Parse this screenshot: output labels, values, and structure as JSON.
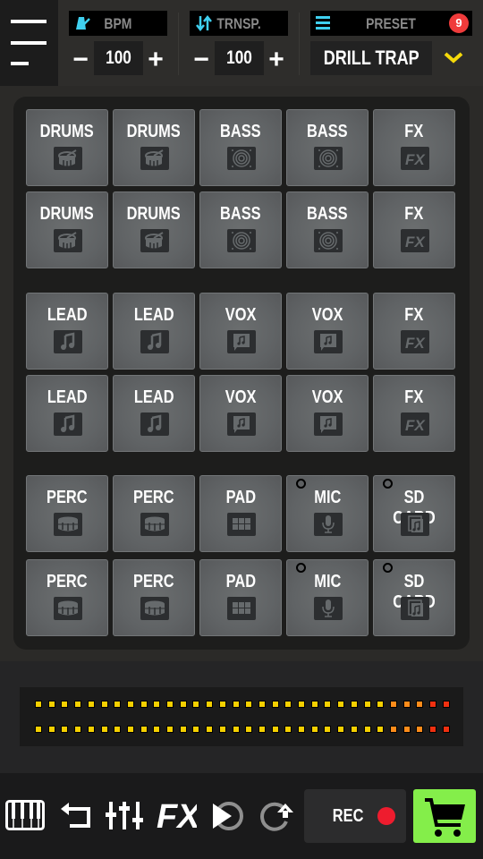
{
  "header": {
    "bpm": {
      "label": "BPM",
      "value": "100",
      "minus": "−",
      "plus": "+",
      "icon": "metronome-icon"
    },
    "transpose": {
      "label": "TRNSP.",
      "value": "100",
      "minus": "−",
      "plus": "+",
      "icon": "transpose-arrows-icon"
    },
    "preset": {
      "label": "PRESET",
      "badge": "9",
      "name": "DRILL TRAP",
      "icon": "list-icon",
      "dropdown_icon": "chevron-down-icon"
    }
  },
  "colors": {
    "accent_cyan": "#3fd0f0",
    "badge_red": "#ef3b3b",
    "chevron_yellow": "#f5d90a",
    "led_yellow": "#f5d000",
    "led_orange": "#ff8c1a",
    "led_red": "#f03010",
    "rec_red": "#ee1c2e",
    "cart_green": "#84ee4a"
  },
  "pad_groups": [
    {
      "rows": [
        [
          {
            "label": "DRUMS",
            "icon": "drum"
          },
          {
            "label": "DRUMS",
            "icon": "drum"
          },
          {
            "label": "BASS",
            "icon": "speaker"
          },
          {
            "label": "BASS",
            "icon": "speaker"
          },
          {
            "label": "FX",
            "icon": "fx"
          }
        ],
        [
          {
            "label": "DRUMS",
            "icon": "drum"
          },
          {
            "label": "DRUMS",
            "icon": "drum"
          },
          {
            "label": "BASS",
            "icon": "speaker"
          },
          {
            "label": "BASS",
            "icon": "speaker"
          },
          {
            "label": "FX",
            "icon": "fx"
          }
        ]
      ]
    },
    {
      "rows": [
        [
          {
            "label": "LEAD",
            "icon": "note"
          },
          {
            "label": "LEAD",
            "icon": "note"
          },
          {
            "label": "VOX",
            "icon": "vox"
          },
          {
            "label": "VOX",
            "icon": "vox"
          },
          {
            "label": "FX",
            "icon": "fx"
          }
        ],
        [
          {
            "label": "LEAD",
            "icon": "note"
          },
          {
            "label": "LEAD",
            "icon": "note"
          },
          {
            "label": "VOX",
            "icon": "vox"
          },
          {
            "label": "VOX",
            "icon": "vox"
          },
          {
            "label": "FX",
            "icon": "fx"
          }
        ]
      ]
    },
    {
      "rows": [
        [
          {
            "label": "PERC",
            "icon": "perc"
          },
          {
            "label": "PERC",
            "icon": "perc"
          },
          {
            "label": "PAD",
            "icon": "grid"
          },
          {
            "label": "MIC",
            "icon": "mic",
            "dot": true
          },
          {
            "label": "SD CARD",
            "icon": "sdcard",
            "dot": true
          }
        ],
        [
          {
            "label": "PERC",
            "icon": "perc"
          },
          {
            "label": "PERC",
            "icon": "perc"
          },
          {
            "label": "PAD",
            "icon": "grid"
          },
          {
            "label": "MIC",
            "icon": "mic",
            "dot": true
          },
          {
            "label": "SD CARD",
            "icon": "sdcard",
            "dot": true
          }
        ]
      ]
    }
  ],
  "level_meter": {
    "channels": 2,
    "segments_per_channel": 32,
    "lit_segments": [
      32,
      32
    ],
    "segment_colors": [
      "yellow",
      "yellow",
      "yellow",
      "yellow",
      "yellow",
      "yellow",
      "yellow",
      "yellow",
      "yellow",
      "yellow",
      "yellow",
      "yellow",
      "yellow",
      "yellow",
      "yellow",
      "yellow",
      "yellow",
      "yellow",
      "yellow",
      "yellow",
      "yellow",
      "yellow",
      "yellow",
      "yellow",
      "yellow",
      "yellow",
      "yellow",
      "orange",
      "orange",
      "orange",
      "red",
      "red"
    ]
  },
  "toolbar": {
    "items": [
      {
        "name": "piano-keys-icon"
      },
      {
        "name": "undo-arrow-icon"
      },
      {
        "name": "mixer-sliders-icon"
      },
      {
        "name": "fx-icon",
        "text": "FX"
      },
      {
        "name": "play-loop-icon"
      },
      {
        "name": "redo-circle-icon"
      }
    ],
    "rec_label": "REC",
    "cart_icon": "shopping-cart-icon"
  }
}
